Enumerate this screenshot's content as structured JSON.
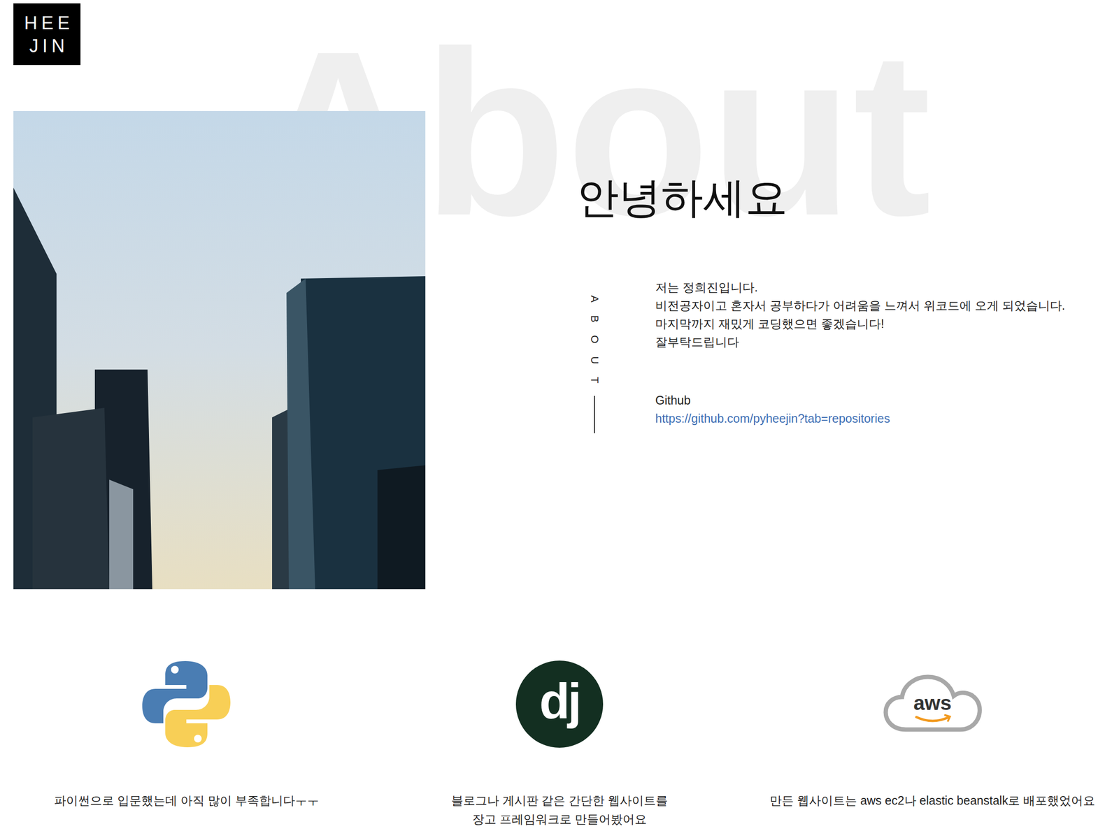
{
  "logo": {
    "lines": [
      "HEE",
      "JIN"
    ]
  },
  "watermark": "About",
  "heading": "안녕하세요",
  "side_label": "ABOUT",
  "intro": [
    "저는 정희진입니다.",
    "비전공자이고 혼자서 공부하다가 어려움을 느껴서 위코드에 오게 되었습니다.",
    "마지막까지 재밌게 코딩했으면 좋겠습니다!",
    "잘부탁드립니다"
  ],
  "github": {
    "label": "Github",
    "url": "https://github.com/pyheejin?tab=repositories"
  },
  "skills": [
    {
      "kind": "python",
      "caption": [
        "파이썬으로 입문했는데 아직 많이 부족합니다ㅜㅜ"
      ]
    },
    {
      "kind": "django",
      "glyph": "dj",
      "caption": [
        "블로그나 게시판 같은 간단한 웹사이트를",
        "장고 프레임워크로 만들어봤어요"
      ]
    },
    {
      "kind": "aws",
      "glyph": "aws",
      "caption": [
        "만든 웹사이트는 aws ec2나 elastic beanstalk로 배포했었어요"
      ]
    }
  ]
}
